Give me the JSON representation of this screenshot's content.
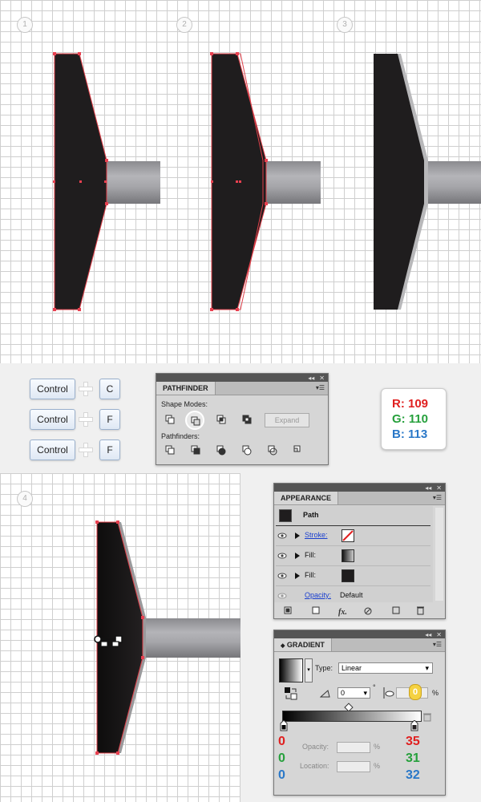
{
  "steps": [
    "1",
    "2",
    "3",
    "4"
  ],
  "shortcuts": [
    {
      "modifier": "Control",
      "key": "C"
    },
    {
      "modifier": "Control",
      "key": "F"
    },
    {
      "modifier": "Control",
      "key": "F"
    }
  ],
  "pathfinder": {
    "title": "PATHFINDER",
    "shape_modes_label": "Shape Modes:",
    "expand_label": "Expand",
    "pathfinders_label": "Pathfinders:"
  },
  "rgb": {
    "r": "R: 109",
    "g": "G: 110",
    "b": "B: 113",
    "r_color": "#e02020",
    "g_color": "#26a03c",
    "b_color": "#2a78c8"
  },
  "appearance": {
    "title": "APPEARANCE",
    "header": "Path",
    "rows": [
      {
        "label": "Stroke:"
      },
      {
        "label": "Fill:"
      },
      {
        "label": "Fill:"
      }
    ],
    "opacity_label": "Opacity:",
    "opacity_value": "Default"
  },
  "gradient": {
    "title": "GRADIENT",
    "type_label": "Type:",
    "type_value": "Linear",
    "angle_value": "0",
    "degree_symbol": "°",
    "percent_symbol": "%",
    "aspect_badge": "0",
    "opacity_label": "Opacity:",
    "location_label": "Location:",
    "left_rgb": [
      "0",
      "0",
      "0"
    ],
    "right_rgb": [
      "35",
      "31",
      "32"
    ]
  }
}
